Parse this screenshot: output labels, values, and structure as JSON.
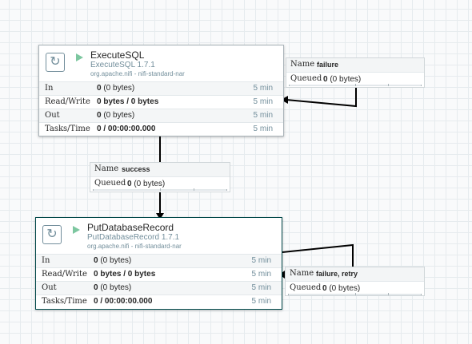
{
  "processors": [
    {
      "name": "ExecuteSQL",
      "type": "ExecuteSQL 1.7.1",
      "bundle": "org.apache.nifi - nifi-standard-nar",
      "icon": "processor-icon",
      "state": "running",
      "stats": [
        {
          "label": "In",
          "count": "0",
          "detail": "(0 bytes)",
          "time": "5 min"
        },
        {
          "label": "Read/Write",
          "count": "0 bytes / 0 bytes",
          "detail": "",
          "time": "5 min"
        },
        {
          "label": "Out",
          "count": "0",
          "detail": "(0 bytes)",
          "time": "5 min"
        },
        {
          "label": "Tasks/Time",
          "count": "0 / 00:00:00.000",
          "detail": "",
          "time": "5 min"
        }
      ]
    },
    {
      "name": "PutDatabaseRecord",
      "type": "PutDatabaseRecord 1.7.1",
      "bundle": "org.apache.nifi - nifi-standard-nar",
      "icon": "processor-icon",
      "state": "running",
      "stats": [
        {
          "label": "In",
          "count": "0",
          "detail": "(0 bytes)",
          "time": "5 min"
        },
        {
          "label": "Read/Write",
          "count": "0 bytes / 0 bytes",
          "detail": "",
          "time": "5 min"
        },
        {
          "label": "Out",
          "count": "0",
          "detail": "(0 bytes)",
          "time": "5 min"
        },
        {
          "label": "Tasks/Time",
          "count": "0 / 00:00:00.000",
          "detail": "",
          "time": "5 min"
        }
      ]
    }
  ],
  "connections": [
    {
      "name_label": "Name",
      "name": "failure",
      "queued_label": "Queued",
      "queued_count": "0",
      "queued_detail": "(0 bytes)"
    },
    {
      "name_label": "Name",
      "name": "success",
      "queued_label": "Queued",
      "queued_count": "0",
      "queued_detail": "(0 bytes)"
    },
    {
      "name_label": "Name",
      "name": "failure, retry",
      "queued_label": "Queued",
      "queued_count": "0",
      "queued_detail": "(0 bytes)"
    }
  ],
  "colors": {
    "running": "#7dc7a0",
    "selected_border": "#004849",
    "secondary_text": "#728e9b"
  }
}
